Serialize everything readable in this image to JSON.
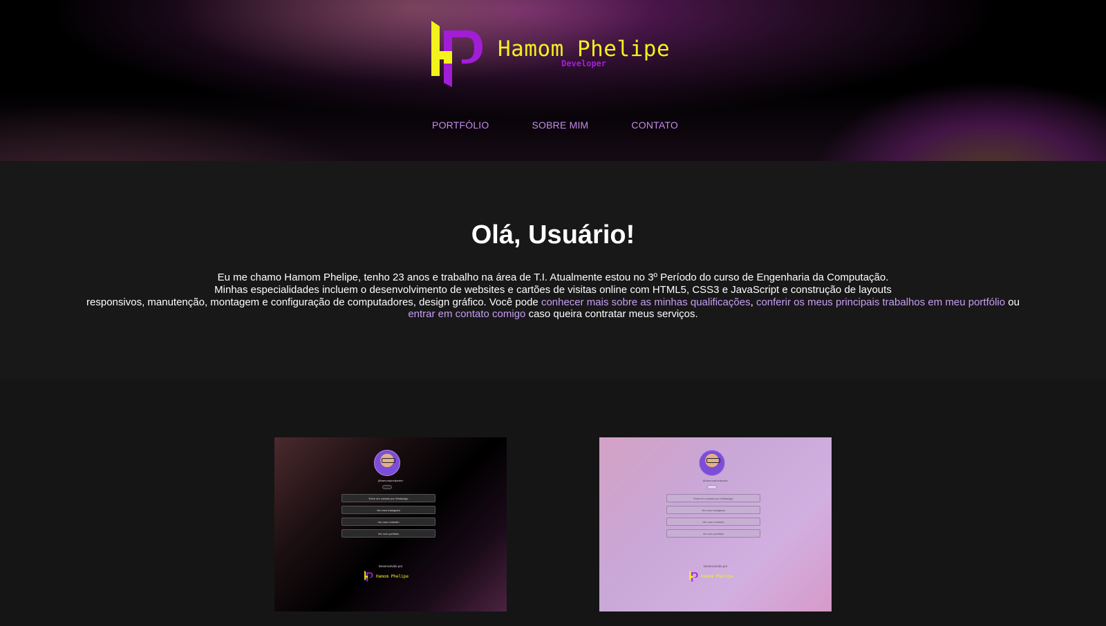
{
  "brand": {
    "name": "Hamom Phelipe",
    "subtitle": "Developer",
    "logo_icon": "hp-logo-icon",
    "colors": {
      "yellow": "#f3f21c",
      "purple": "#a21ed6"
    }
  },
  "nav": {
    "items": [
      {
        "label": "PORTFÓLIO"
      },
      {
        "label": "SOBRE MIM"
      },
      {
        "label": "CONTATO"
      }
    ],
    "color": "#c78bf0"
  },
  "intro": {
    "heading": "Olá, Usuário!",
    "line1": "Eu me chamo Hamom Phelipe, tenho 23 anos e trabalho na área de T.I. Atualmente estou no 3º Período do curso de Engenharia da Computação.",
    "line2": "Minhas especialidades incluem o desenvolvimento de websites e cartões de visitas online com HTML5, CSS3 e JavaScript e construção de layouts",
    "line3_start": "responsivos, manutenção, montagem e configuração de computadores, design gráfico. Você pode ",
    "link_qualificacoes": "conhecer mais sobre as minhas qualificações",
    "sep1": ", ",
    "link_portfolio": "conferir os meus principais trabalhos em meu portfólio",
    "sep2": " ou",
    "link_contato": "entrar em contato comigo",
    "line4_end": " caso queira contratar meus serviços.",
    "link_color": "#c79ef5"
  },
  "portfolio": {
    "cards": [
      {
        "theme": "dark",
        "user": "@hamomphelipedev",
        "buttons": [
          "Entre em contato por WhatsApp",
          "Ver meu Instagram",
          "Ver meu LinkedIn",
          "Ver meu portfólio"
        ],
        "dev_label": "Desenvolvido por",
        "brand": "Hamom Phelipe"
      },
      {
        "theme": "light",
        "user": "@hamomphelipedev",
        "buttons": [
          "Entre em contato por WhatsApp",
          "Ver meu Instagram",
          "Ver meu LinkedIn",
          "Ver meu portfólio"
        ],
        "dev_label": "Desenvolvido por",
        "brand": "Hamom Phelipe"
      }
    ]
  }
}
